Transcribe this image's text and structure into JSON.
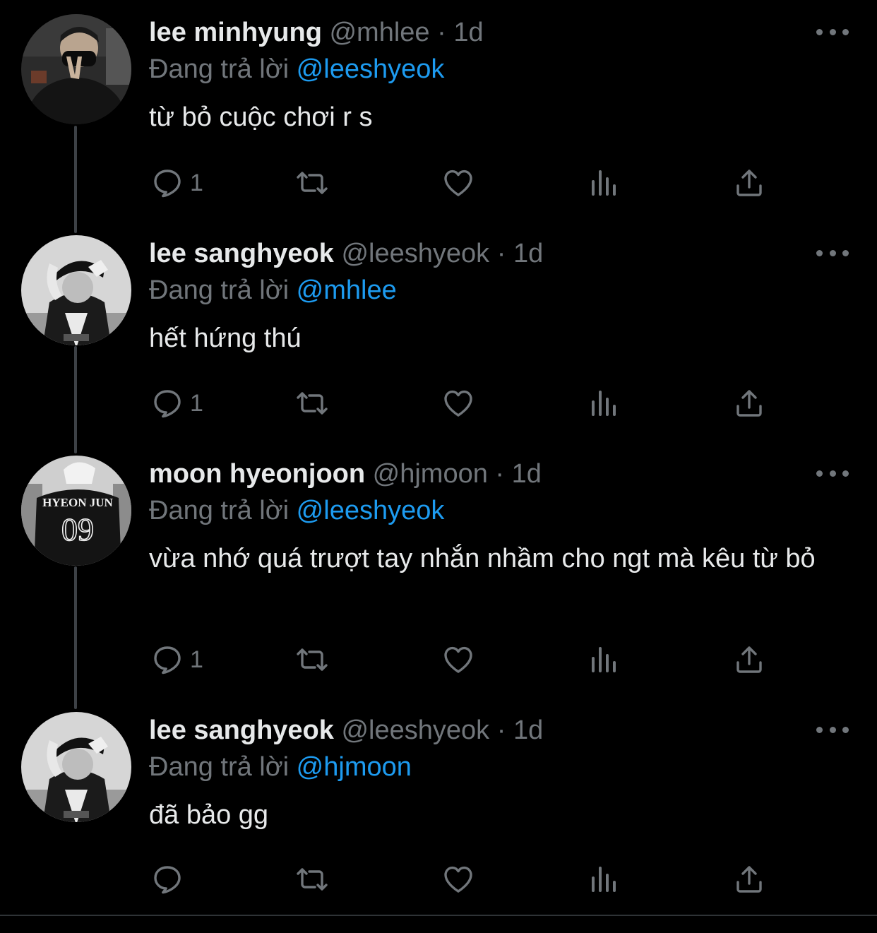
{
  "theme": {
    "background": "#000000",
    "text": "#e7e9ea",
    "muted": "#71767b",
    "accent": "#1d9bf0"
  },
  "tweets": [
    {
      "name": "lee minhyung",
      "handle": "@mhlee",
      "dot": "·",
      "time": "1d",
      "reply_prefix": "Đang trả lời",
      "reply_to": "@leeshyeok",
      "text": "từ bỏ cuộc chơi r s",
      "reply_count": "1",
      "avatar": "person-mask-peace-sign"
    },
    {
      "name": "lee sanghyeok",
      "handle": "@leeshyeok",
      "dot": "·",
      "time": "1d",
      "reply_prefix": "Đang trả lời",
      "reply_to": "@mhlee",
      "text": "hết hứng thú",
      "reply_count": "1",
      "avatar": "person-cap-bw"
    },
    {
      "name": "moon hyeonjoon",
      "handle": "@hjmoon",
      "dot": "·",
      "time": "1d",
      "reply_prefix": "Đang trả lời",
      "reply_to": "@leeshyeok",
      "text": "vừa nhớ quá trượt tay nhắn nhầm cho ngt mà kêu từ bỏ",
      "reply_count": "1",
      "avatar": "jersey-back",
      "avatar_text": {
        "name": "HYEON JUN",
        "number": "09"
      }
    },
    {
      "name": "lee sanghyeok",
      "handle": "@leeshyeok",
      "dot": "·",
      "time": "1d",
      "reply_prefix": "Đang trả lời",
      "reply_to": "@hjmoon",
      "text": "đã bảo gg",
      "reply_count": "",
      "avatar": "person-cap-bw"
    }
  ],
  "icons": [
    "reply-icon",
    "retweet-icon",
    "like-icon",
    "views-icon",
    "share-icon",
    "more-icon"
  ]
}
